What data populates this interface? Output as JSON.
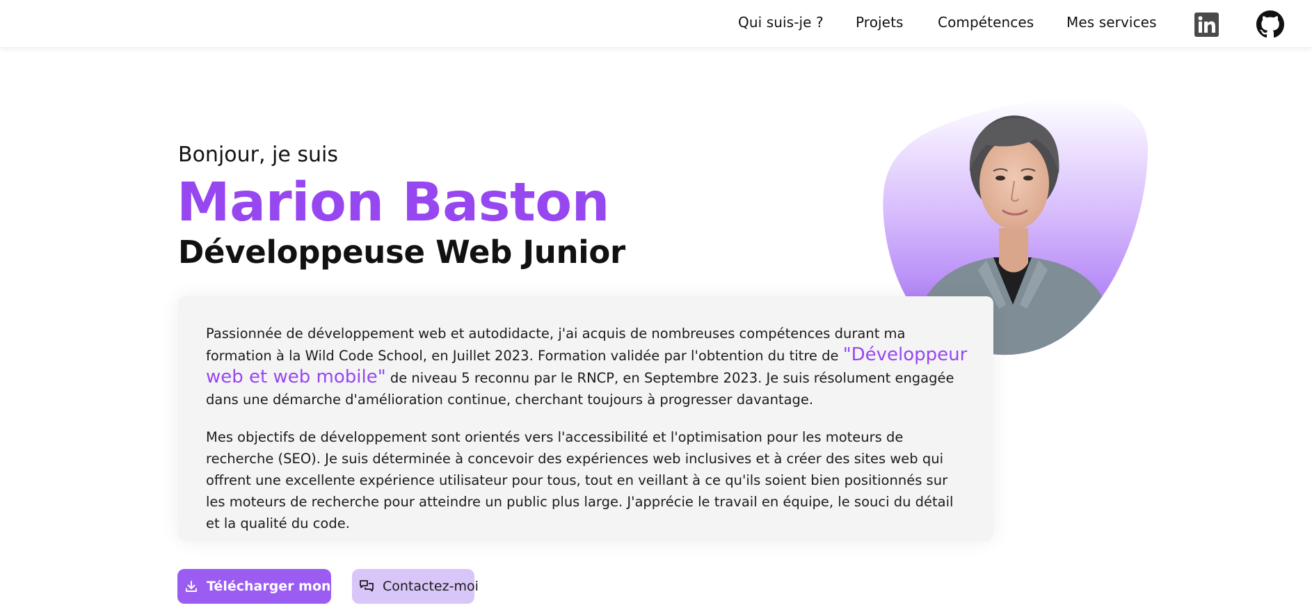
{
  "nav": {
    "items": [
      {
        "label": "Qui suis-je ?"
      },
      {
        "label": "Projets"
      },
      {
        "label": "Compétences"
      },
      {
        "label": "Mes services"
      }
    ],
    "social": [
      {
        "icon": "linkedin-icon"
      },
      {
        "icon": "github-icon"
      }
    ]
  },
  "hero": {
    "greeting": "Bonjour, je suis",
    "name": "Marion Baston",
    "role": "Développeuse Web Junior"
  },
  "bio": {
    "p1_before": "Passionnée de développement web et autodidacte, j'ai acquis de nombreuses compétences durant ma formation à la Wild Code School, en Juillet 2023. Formation validée par l'obtention du titre de ",
    "p1_highlight": "\"Développeur web et web mobile\"",
    "p1_after": " de niveau 5 reconnu par le RNCP, en Septembre 2023. Je suis résolument engagée dans une démarche d'amélioration continue, cherchant toujours à progresser davantage.",
    "p2": "Mes objectifs de développement sont orientés vers l'accessibilité et l'optimisation pour les moteurs de recherche (SEO). Je suis déterminée à concevoir des expériences web inclusives et à créer des sites web qui offrent une excellente expérience utilisateur pour tous, tout en veillant à ce qu'ils soient bien positionnés sur les moteurs de recherche pour atteindre un public plus large. J'apprécie le travail en équipe, le souci du détail et la qualité du code."
  },
  "buttons": {
    "cv": {
      "label": "Télécharger mon CV",
      "icon": "download-icon"
    },
    "contact": {
      "label": "Contactez-moi",
      "icon": "chat-icon"
    }
  },
  "colors": {
    "accent": "#9747f0",
    "button_primary": "#9b5cf1",
    "button_secondary": "#d8c6f9",
    "card_bg": "#f4f4f5"
  }
}
